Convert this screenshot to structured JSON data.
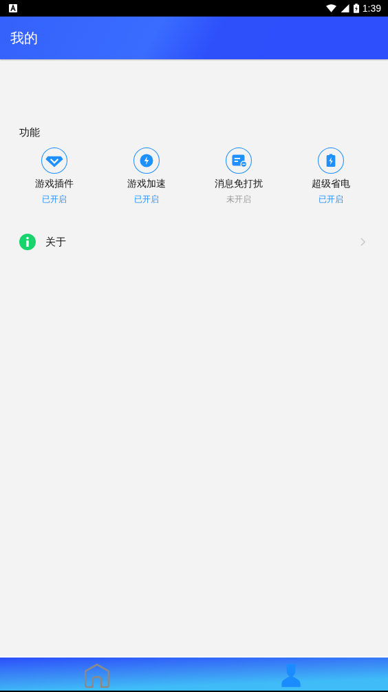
{
  "status_bar": {
    "time": "1:39"
  },
  "header": {
    "title": "我的"
  },
  "features": {
    "title": "功能",
    "items": [
      {
        "kind": "gem",
        "label": "游戏插件",
        "status": "已开启",
        "on": true
      },
      {
        "kind": "bolt",
        "label": "游戏加速",
        "status": "已开启",
        "on": true
      },
      {
        "kind": "message",
        "label": "消息免打扰",
        "status": "未开启",
        "on": false
      },
      {
        "kind": "battery",
        "label": "超级省电",
        "status": "已开启",
        "on": true
      }
    ]
  },
  "menu": [
    {
      "label": "关于"
    }
  ],
  "bottom_nav": [
    {
      "kind": "home",
      "selected": false
    },
    {
      "kind": "profile",
      "selected": true
    }
  ]
}
